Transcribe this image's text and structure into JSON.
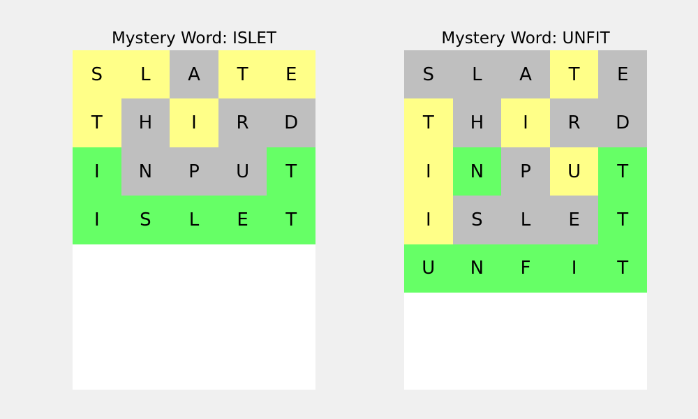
{
  "colors": {
    "absent": "#bfbfbf",
    "present": "#ffff88",
    "correct": "#66ff66",
    "empty": "#ffffff",
    "background": "#f0f0f0"
  },
  "boards": [
    {
      "title": "Mystery Word: ISLET",
      "rows": [
        {
          "letters": [
            "S",
            "L",
            "A",
            "T",
            "E"
          ],
          "states": [
            "present",
            "present",
            "absent",
            "present",
            "present"
          ]
        },
        {
          "letters": [
            "T",
            "H",
            "I",
            "R",
            "D"
          ],
          "states": [
            "present",
            "absent",
            "present",
            "absent",
            "absent"
          ]
        },
        {
          "letters": [
            "I",
            "N",
            "P",
            "U",
            "T"
          ],
          "states": [
            "correct",
            "absent",
            "absent",
            "absent",
            "correct"
          ]
        },
        {
          "letters": [
            "I",
            "S",
            "L",
            "E",
            "T"
          ],
          "states": [
            "correct",
            "correct",
            "correct",
            "correct",
            "correct"
          ]
        },
        {
          "letters": [
            "",
            "",
            "",
            "",
            ""
          ],
          "states": [
            "empty",
            "empty",
            "empty",
            "empty",
            "empty"
          ]
        },
        {
          "letters": [
            "",
            "",
            "",
            "",
            ""
          ],
          "states": [
            "empty",
            "empty",
            "empty",
            "empty",
            "empty"
          ]
        },
        {
          "letters": [
            "",
            "",
            "",
            "",
            ""
          ],
          "states": [
            "empty",
            "empty",
            "empty",
            "empty",
            "empty"
          ]
        }
      ]
    },
    {
      "title": "Mystery Word: UNFIT",
      "rows": [
        {
          "letters": [
            "S",
            "L",
            "A",
            "T",
            "E"
          ],
          "states": [
            "absent",
            "absent",
            "absent",
            "present",
            "absent"
          ]
        },
        {
          "letters": [
            "T",
            "H",
            "I",
            "R",
            "D"
          ],
          "states": [
            "present",
            "absent",
            "present",
            "absent",
            "absent"
          ]
        },
        {
          "letters": [
            "I",
            "N",
            "P",
            "U",
            "T"
          ],
          "states": [
            "present",
            "correct",
            "absent",
            "present",
            "correct"
          ]
        },
        {
          "letters": [
            "I",
            "S",
            "L",
            "E",
            "T"
          ],
          "states": [
            "present",
            "absent",
            "absent",
            "absent",
            "correct"
          ]
        },
        {
          "letters": [
            "U",
            "N",
            "F",
            "I",
            "T"
          ],
          "states": [
            "correct",
            "correct",
            "correct",
            "correct",
            "correct"
          ]
        },
        {
          "letters": [
            "",
            "",
            "",
            "",
            ""
          ],
          "states": [
            "empty",
            "empty",
            "empty",
            "empty",
            "empty"
          ]
        },
        {
          "letters": [
            "",
            "",
            "",
            "",
            ""
          ],
          "states": [
            "empty",
            "empty",
            "empty",
            "empty",
            "empty"
          ]
        }
      ]
    }
  ]
}
